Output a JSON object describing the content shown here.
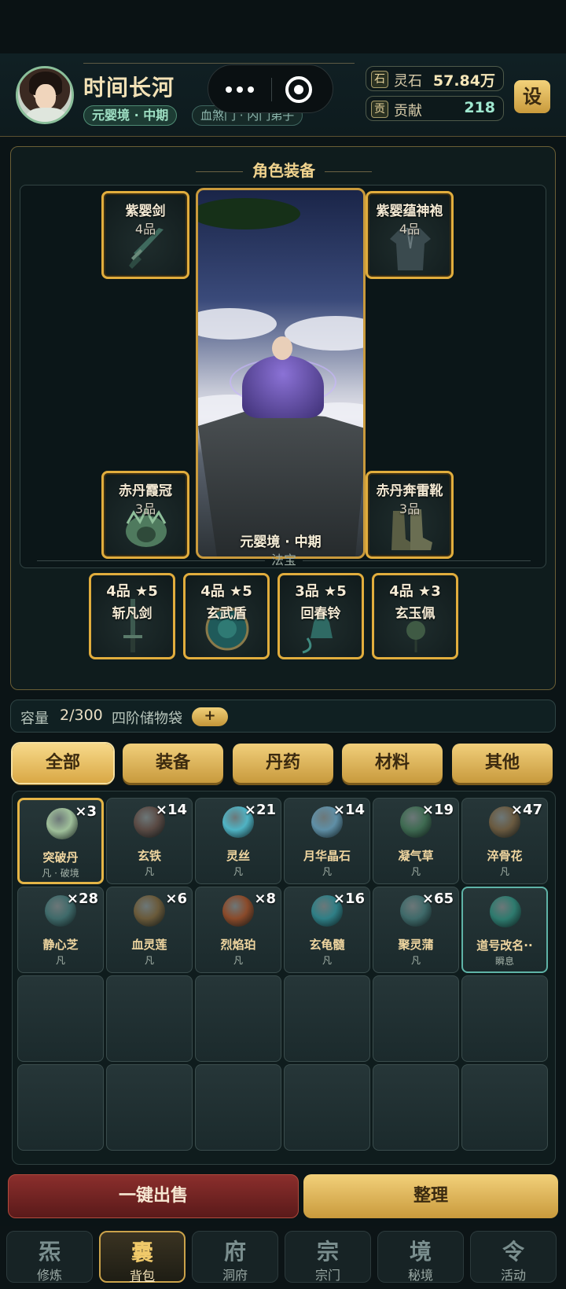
{
  "header": {
    "player_name": "时间长河",
    "realm": "元婴境 · 中期",
    "sect": "血煞门 · 内门弟子",
    "resources": [
      {
        "icon_char": "石",
        "icon": "spirit-stone-icon",
        "label": "灵石",
        "value": "57.84万",
        "color": "#f5e6b8"
      },
      {
        "icon_char": "贡",
        "icon": "contribution-icon",
        "label": "贡献",
        "value": "218",
        "color": "#9fe7cf"
      }
    ],
    "settings_label": "设"
  },
  "equipment": {
    "title": "角色装备",
    "slots": [
      {
        "name": "紫婴剑",
        "grade": "4品",
        "icon": "sword-icon"
      },
      {
        "name": "紫婴蕴神袍",
        "grade": "4品",
        "icon": "robe-icon"
      },
      {
        "name": "赤丹霞冠",
        "grade": "3品",
        "icon": "crown-icon"
      },
      {
        "name": "赤丹奔雷靴",
        "grade": "3品",
        "icon": "boots-icon"
      }
    ],
    "portrait_caption": "元婴境 · 中期",
    "fabao_label": "法宝",
    "fabao": [
      {
        "grade": "4品 ★5",
        "name": "斩凡剑",
        "icon": "sword-icon"
      },
      {
        "grade": "4品 ★5",
        "name": "玄武盾",
        "icon": "shield-icon"
      },
      {
        "grade": "3品 ★5",
        "name": "回春铃",
        "icon": "bell-icon"
      },
      {
        "grade": "4品 ★3",
        "name": "玄玉佩",
        "icon": "pendant-icon"
      }
    ]
  },
  "capacity": {
    "label": "容量",
    "value": "2/300",
    "bag": "四阶储物袋",
    "add_label": "+"
  },
  "tabs": [
    "全部",
    "装备",
    "丹药",
    "材料",
    "其他"
  ],
  "items": [
    {
      "name": "突破丹",
      "count": "×3",
      "quality": "凡 · 破境",
      "color": "#9fbf9a"
    },
    {
      "name": "玄铁",
      "count": "×14",
      "quality": "凡",
      "color": "#5a4a44"
    },
    {
      "name": "灵丝",
      "count": "×21",
      "quality": "凡",
      "color": "#4fb3c4"
    },
    {
      "name": "月华晶石",
      "count": "×14",
      "quality": "凡",
      "color": "#5f8fa6"
    },
    {
      "name": "凝气草",
      "count": "×19",
      "quality": "凡",
      "color": "#3f6b52"
    },
    {
      "name": "淬骨花",
      "count": "×47",
      "quality": "凡",
      "color": "#6a5a40"
    },
    {
      "name": "静心芝",
      "count": "×28",
      "quality": "凡",
      "color": "#3f6a6a"
    },
    {
      "name": "血灵莲",
      "count": "×6",
      "quality": "凡",
      "color": "#6a5a3a"
    },
    {
      "name": "烈焰珀",
      "count": "×8",
      "quality": "凡",
      "color": "#8a4a2a"
    },
    {
      "name": "玄龟髓",
      "count": "×16",
      "quality": "凡",
      "color": "#2f7f86"
    },
    {
      "name": "聚灵蒲",
      "count": "×65",
      "quality": "凡",
      "color": "#3f6a6a"
    },
    {
      "name": "道号改名··",
      "count": "",
      "quality": "瞬息",
      "color": "#2e7a6e"
    }
  ],
  "actions": {
    "sell_all": "一键出售",
    "sort": "整理"
  },
  "nav": [
    {
      "glyph": "炁",
      "label": "修炼"
    },
    {
      "glyph": "囊",
      "label": "背包"
    },
    {
      "glyph": "府",
      "label": "洞府"
    },
    {
      "glyph": "宗",
      "label": "宗门"
    },
    {
      "glyph": "境",
      "label": "秘境"
    },
    {
      "glyph": "令",
      "label": "活动"
    }
  ],
  "active_tab": "全部",
  "active_nav": "背包"
}
